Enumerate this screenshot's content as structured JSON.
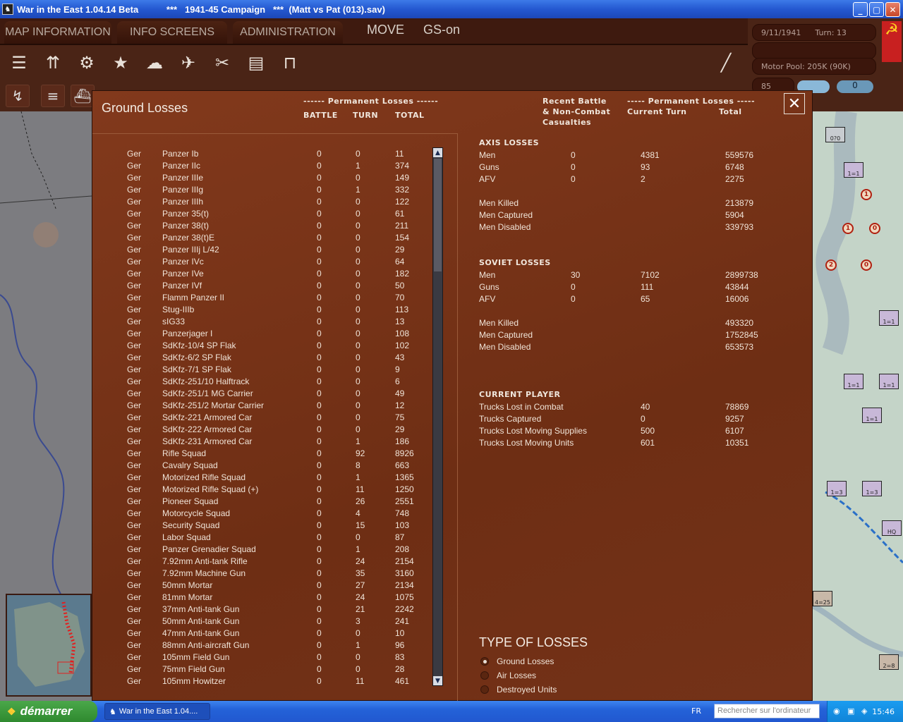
{
  "window": {
    "title": "War in the East 1.04.14 Beta           ***   1941-45 Campaign   ***  (Matt vs Pat (013).sav)",
    "minimize": "_",
    "maximize": "▢",
    "close": "✕"
  },
  "menu": {
    "tabs": [
      "MAP INFORMATION",
      "INFO SCREENS",
      "ADMINISTRATION"
    ],
    "mode": "MOVE",
    "gs": "GS-on"
  },
  "status": {
    "date": "9/11/1941",
    "turn": "Turn: 13",
    "motor_pool": "Motor Pool: 205K (90K)",
    "counter_a": "85",
    "counter_b": "0"
  },
  "dialog": {
    "title": "Ground Losses",
    "close": "✕",
    "left_header": {
      "group": "------ Permanent Losses ------",
      "battle": "BATTLE",
      "turn": "TURN",
      "total": "TOTAL"
    },
    "right_header": {
      "recent": "Recent Battle\n& Non-Combat\nCasualties",
      "group": "----- Permanent Losses -----",
      "current": "Current Turn",
      "total": "Total"
    },
    "rows": [
      [
        "Ger",
        "Panzer Ib",
        "0",
        "0",
        "11"
      ],
      [
        "Ger",
        "Panzer IIc",
        "0",
        "1",
        "374"
      ],
      [
        "Ger",
        "Panzer IIIe",
        "0",
        "0",
        "149"
      ],
      [
        "Ger",
        "Panzer IIIg",
        "0",
        "1",
        "332"
      ],
      [
        "Ger",
        "Panzer IIIh",
        "0",
        "0",
        "122"
      ],
      [
        "Ger",
        "Panzer 35(t)",
        "0",
        "0",
        "61"
      ],
      [
        "Ger",
        "Panzer 38(t)",
        "0",
        "0",
        "211"
      ],
      [
        "Ger",
        "Panzer 38(t)E",
        "0",
        "0",
        "154"
      ],
      [
        "Ger",
        "Panzer IIIj L/42",
        "0",
        "0",
        "29"
      ],
      [
        "Ger",
        "Panzer IVc",
        "0",
        "0",
        "64"
      ],
      [
        "Ger",
        "Panzer IVe",
        "0",
        "0",
        "182"
      ],
      [
        "Ger",
        "Panzer IVf",
        "0",
        "0",
        "50"
      ],
      [
        "Ger",
        "Flamm Panzer II",
        "0",
        "0",
        "70"
      ],
      [
        "Ger",
        "Stug-IIIb",
        "0",
        "0",
        "113"
      ],
      [
        "Ger",
        "sIG33",
        "0",
        "0",
        "13"
      ],
      [
        "Ger",
        "Panzerjager I",
        "0",
        "0",
        "108"
      ],
      [
        "Ger",
        "SdKfz-10/4 SP Flak",
        "0",
        "0",
        "102"
      ],
      [
        "Ger",
        "SdKfz-6/2 SP Flak",
        "0",
        "0",
        "43"
      ],
      [
        "Ger",
        "SdKfz-7/1 SP Flak",
        "0",
        "0",
        "9"
      ],
      [
        "Ger",
        "SdKfz-251/10 Halftrack",
        "0",
        "0",
        "6"
      ],
      [
        "Ger",
        "SdKfz-251/1 MG Carrier",
        "0",
        "0",
        "49"
      ],
      [
        "Ger",
        "SdKfz-251/2 Mortar Carrier",
        "0",
        "0",
        "12"
      ],
      [
        "Ger",
        "SdKfz-221 Armored Car",
        "0",
        "0",
        "75"
      ],
      [
        "Ger",
        "SdKfz-222 Armored Car",
        "0",
        "0",
        "29"
      ],
      [
        "Ger",
        "SdKfz-231 Armored Car",
        "0",
        "1",
        "186"
      ],
      [
        "Ger",
        "Rifle Squad",
        "0",
        "92",
        "8926"
      ],
      [
        "Ger",
        "Cavalry Squad",
        "0",
        "8",
        "663"
      ],
      [
        "Ger",
        "Motorized Rifle Squad",
        "0",
        "1",
        "1365"
      ],
      [
        "Ger",
        "Motorized Rifle Squad (+)",
        "0",
        "11",
        "1250"
      ],
      [
        "Ger",
        "Pioneer Squad",
        "0",
        "26",
        "2551"
      ],
      [
        "Ger",
        "Motorcycle Squad",
        "0",
        "4",
        "748"
      ],
      [
        "Ger",
        "Security Squad",
        "0",
        "15",
        "103"
      ],
      [
        "Ger",
        "Labor Squad",
        "0",
        "0",
        "87"
      ],
      [
        "Ger",
        "Panzer Grenadier Squad",
        "0",
        "1",
        "208"
      ],
      [
        "Ger",
        "7.92mm Anti-tank Rifle",
        "0",
        "24",
        "2154"
      ],
      [
        "Ger",
        "7.92mm Machine Gun",
        "0",
        "35",
        "3160"
      ],
      [
        "Ger",
        "50mm Mortar",
        "0",
        "27",
        "2134"
      ],
      [
        "Ger",
        "81mm Mortar",
        "0",
        "24",
        "1075"
      ],
      [
        "Ger",
        "37mm Anti-tank Gun",
        "0",
        "21",
        "2242"
      ],
      [
        "Ger",
        "50mm Anti-tank Gun",
        "0",
        "3",
        "241"
      ],
      [
        "Ger",
        "47mm Anti-tank Gun",
        "0",
        "0",
        "10"
      ],
      [
        "Ger",
        "88mm Anti-aircraft Gun",
        "0",
        "1",
        "96"
      ],
      [
        "Ger",
        "105mm Field Gun",
        "0",
        "0",
        "83"
      ],
      [
        "Ger",
        "75mm Field Gun",
        "0",
        "0",
        "28"
      ],
      [
        "Ger",
        "105mm Howitzer",
        "0",
        "11",
        "461"
      ]
    ],
    "axis": {
      "title": "AXIS LOSSES",
      "rows": [
        [
          "Men",
          "0",
          "4381",
          "559576"
        ],
        [
          "Guns",
          "0",
          "93",
          "6748"
        ],
        [
          "AFV",
          "0",
          "2",
          "2275"
        ]
      ],
      "killed": [
        "Men Killed",
        "213879"
      ],
      "captured": [
        "Men Captured",
        "5904"
      ],
      "disabled": [
        "Men Disabled",
        "339793"
      ]
    },
    "soviet": {
      "title": "SOVIET LOSSES",
      "rows": [
        [
          "Men",
          "30",
          "7102",
          "2899738"
        ],
        [
          "Guns",
          "0",
          "111",
          "43844"
        ],
        [
          "AFV",
          "0",
          "65",
          "16006"
        ]
      ],
      "killed": [
        "Men Killed",
        "493320"
      ],
      "captured": [
        "Men Captured",
        "1752845"
      ],
      "disabled": [
        "Men Disabled",
        "653573"
      ]
    },
    "player": {
      "title": "CURRENT PLAYER",
      "rows": [
        [
          "Trucks Lost in Combat",
          "40",
          "78869"
        ],
        [
          "Trucks Captured",
          "0",
          "9257"
        ],
        [
          "Trucks Lost Moving Supplies",
          "500",
          "6107"
        ],
        [
          "Trucks Lost Moving Units",
          "601",
          "10351"
        ]
      ]
    },
    "types": {
      "title": "TYPE OF LOSSES",
      "options": [
        "Ground Losses",
        "Air Losses",
        "Destroyed Units"
      ],
      "selected": 0
    }
  },
  "map_units": [
    "0?0",
    "1=1",
    "1=1",
    "1=1",
    "1=1",
    "1=3",
    "1=3",
    "HQ",
    "1=1",
    "4=25",
    "2=8"
  ],
  "taskbar": {
    "start": "démarrer",
    "task": "War in the East 1.04....",
    "lang": "FR",
    "search_placeholder": "Rechercher sur l'ordinateur",
    "clock": "15:46"
  }
}
